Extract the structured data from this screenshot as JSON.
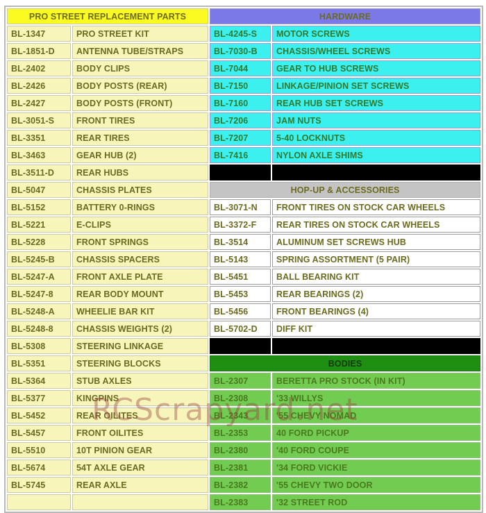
{
  "watermark": {
    "text": "RCScrapyard.net"
  },
  "table": {
    "left_headers": [
      "",
      ""
    ],
    "right_headers": [
      "",
      ""
    ],
    "sections": {
      "pro_street": {
        "title": "PRO STREET REPLACEMENT PARTS"
      },
      "hardware": {
        "title": "HARDWARE"
      },
      "hopup": {
        "title": "HOP-UP & ACCESSORIES"
      },
      "bodies": {
        "title": "BODIES"
      }
    },
    "rows": [
      {
        "l_code": "BL-1347",
        "l_name": "PRO STREET KIT",
        "l_style": "cream",
        "r_code": "BL-4245-S",
        "r_name": "MOTOR SCREWS",
        "r_style": "cyan"
      },
      {
        "l_code": "BL-1851-D",
        "l_name": "ANTENNA TUBE/STRAPS",
        "l_style": "cream",
        "r_code": "BL-7030-B",
        "r_name": "CHASSIS/WHEEL SCREWS",
        "r_style": "cyan"
      },
      {
        "l_code": "BL-2402",
        "l_name": "BODY CLIPS",
        "l_style": "cream",
        "r_code": "BL-7044",
        "r_name": "GEAR TO HUB SCREWS",
        "r_style": "cyan"
      },
      {
        "l_code": "BL-2426",
        "l_name": "BODY POSTS (REAR)",
        "l_style": "cream",
        "r_code": "BL-7150",
        "r_name": "LINKAGE/PINION SET SCREWS",
        "r_style": "cyan"
      },
      {
        "l_code": "BL-2427",
        "l_name": "BODY POSTS (FRONT)",
        "l_style": "cream",
        "r_code": "BL-7160",
        "r_name": "REAR HUB SET SCREWS",
        "r_style": "cyan"
      },
      {
        "l_code": "BL-3051-S",
        "l_name": "FRONT TIRES",
        "l_style": "cream",
        "r_code": "BL-7206",
        "r_name": "JAM NUTS",
        "r_style": "cyan"
      },
      {
        "l_code": "BL-3351",
        "l_name": "REAR TIRES",
        "l_style": "cream",
        "r_code": "BL-7207",
        "r_name": "5-40 LOCKNUTS",
        "r_style": "cyan"
      },
      {
        "l_code": "BL-3463",
        "l_name": "GEAR HUB (2)",
        "l_style": "cream",
        "r_code": "BL-7416",
        "r_name": "NYLON AXLE SHIMS",
        "r_style": "cyan"
      },
      {
        "l_code": "BL-3511-D",
        "l_name": "REAR HUBS",
        "l_style": "cream",
        "r_code": "",
        "r_name": "",
        "r_style": "black"
      },
      {
        "l_code": "BL-5047",
        "l_name": "CHASSIS PLATES",
        "l_style": "cream",
        "r_span": "HOP-UP & ACCESSORIES",
        "r_style": "hdr-grey"
      },
      {
        "l_code": "BL-5152",
        "l_name": "BATTERY 0-RINGS",
        "l_style": "cream",
        "r_code": "BL-3071-N",
        "r_name": "FRONT TIRES ON STOCK CAR WHEELS",
        "r_style": "white"
      },
      {
        "l_code": "BL-5221",
        "l_name": "E-CLIPS",
        "l_style": "cream",
        "r_code": "BL-3372-F",
        "r_name": "REAR TIRES ON STOCK CAR WHEELS",
        "r_style": "white"
      },
      {
        "l_code": "BL-5228",
        "l_name": "FRONT SPRINGS",
        "l_style": "cream",
        "r_code": "BL-3514",
        "r_name": "ALUMINUM SET SCREWS HUB",
        "r_style": "white"
      },
      {
        "l_code": "BL-5245-B",
        "l_name": "CHASSIS SPACERS",
        "l_style": "cream",
        "r_code": "BL-5143",
        "r_name": "SPRING ASSORTMENT (5 PAIR)",
        "r_style": "white"
      },
      {
        "l_code": "BL-5247-A",
        "l_name": "FRONT AXLE PLATE",
        "l_style": "cream",
        "r_code": "BL-5451",
        "r_name": "BALL BEARING KIT",
        "r_style": "white"
      },
      {
        "l_code": "BL-5247-8",
        "l_name": "REAR BODY MOUNT",
        "l_style": "cream",
        "r_code": "BL-5453",
        "r_name": "REAR BEARINGS (2)",
        "r_style": "white"
      },
      {
        "l_code": "BL-5248-A",
        "l_name": "WHEELIE BAR KIT",
        "l_style": "cream",
        "r_code": "BL-5456",
        "r_name": "FRONT BEARINGS (4)",
        "r_style": "white"
      },
      {
        "l_code": "BL-5248-8",
        "l_name": "CHASSIS WEIGHTS (2)",
        "l_style": "cream",
        "r_code": "BL-5702-D",
        "r_name": "DIFF KIT",
        "r_style": "white"
      },
      {
        "l_code": "BL-5308",
        "l_name": "STEERING LINKAGE",
        "l_style": "cream",
        "r_code": "",
        "r_name": "",
        "r_style": "black"
      },
      {
        "l_code": "BL-5351",
        "l_name": "STEERING BLOCKS",
        "l_style": "cream",
        "r_span": "BODIES",
        "r_style": "hdr-darkgreen"
      },
      {
        "l_code": "BL-5364",
        "l_name": "STUB AXLES",
        "l_style": "cream",
        "r_code": "BL-2307",
        "r_name": "BERETTA PRO STOCK (IN KIT)",
        "r_style": "green"
      },
      {
        "l_code": "BL-5377",
        "l_name": "KINGPINS",
        "l_style": "cream",
        "r_code": "BL-2308",
        "r_name": "'33 WILLYS",
        "r_style": "green"
      },
      {
        "l_code": "BL-5452",
        "l_name": "REAR OILITES",
        "l_style": "cream",
        "r_code": "BL-2343",
        "r_name": "'55 CHEVY NOMAD",
        "r_style": "green"
      },
      {
        "l_code": "BL-5457",
        "l_name": "FRONT OILITES",
        "l_style": "cream",
        "r_code": "BL-2353",
        "r_name": "40 FORD PICKUP",
        "r_style": "green"
      },
      {
        "l_code": "BL-5510",
        "l_name": "10T PINION GEAR",
        "l_style": "cream",
        "r_code": "BL-2380",
        "r_name": "'40 FORD COUPE",
        "r_style": "green"
      },
      {
        "l_code": "BL-5674",
        "l_name": "54T AXLE GEAR",
        "l_style": "cream",
        "r_code": "BL-2381",
        "r_name": "'34 FORD VICKIE",
        "r_style": "green"
      },
      {
        "l_code": "BL-5745",
        "l_name": "REAR AXLE",
        "l_style": "cream",
        "r_code": "BL-2382",
        "r_name": "'55 CHEVY TWO DOOR",
        "r_style": "green"
      },
      {
        "l_code": "",
        "l_name": "",
        "l_style": "cream-empty",
        "r_code": "BL-2383",
        "r_name": "'32 STREET ROD",
        "r_style": "green"
      }
    ]
  }
}
